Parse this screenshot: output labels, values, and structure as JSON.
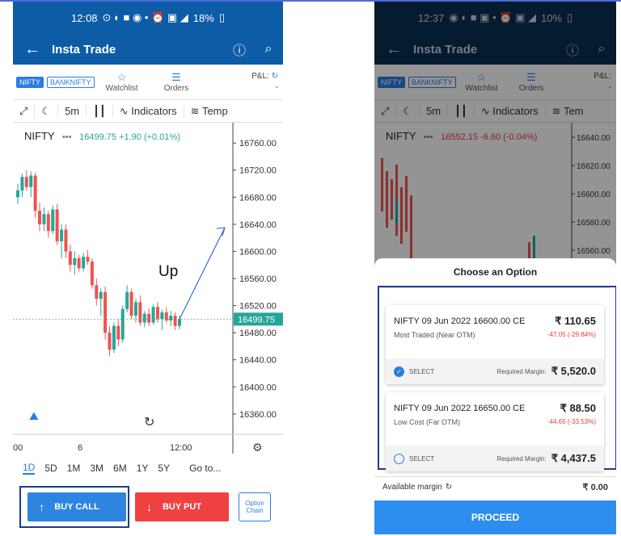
{
  "screens": [
    {
      "status": {
        "time": "12:08",
        "battery": "18%"
      },
      "appbar": {
        "title": "Insta Trade"
      },
      "tabs": {
        "chips": [
          "NIFTY",
          "BANKNIFTY"
        ],
        "watchlist": "Watchlist",
        "orders": "Orders",
        "pnl_label": "P&L:",
        "pnl_value": "-"
      },
      "toolbar": {
        "interval": "5m",
        "indicators": "Indicators",
        "template": "Temp"
      },
      "chart": {
        "symbol": "NIFTY",
        "quote": "16499.75 +1.90 (+0.01%)",
        "quote_color": "#26a69a",
        "price_tag": "16499.75",
        "annotation": "Up",
        "x_ticks": [
          "00",
          "6",
          "12:00"
        ]
      },
      "ranges": [
        "1D",
        "5D",
        "1M",
        "3M",
        "6M",
        "1Y",
        "5Y",
        "Go to..."
      ],
      "buttons": {
        "buy_call": "BUY CALL",
        "buy_put": "BUY PUT",
        "option_chain": "Option Chain"
      }
    },
    {
      "status": {
        "time": "12:37",
        "battery": "10%"
      },
      "appbar": {
        "title": "Insta Trade"
      },
      "tabs": {
        "chips": [
          "NIFTY",
          "BANKNIFTY"
        ],
        "watchlist": "Watchlist",
        "orders": "Orders",
        "pnl_label": "P&L:",
        "pnl_value": "-"
      },
      "toolbar": {
        "interval": "5m",
        "indicators": "Indicators",
        "template": "Tem"
      },
      "chart": {
        "symbol": "NIFTY",
        "quote": "16552.15 -6.60 (-0.04%)",
        "quote_color": "#e23b3b"
      },
      "sheet": {
        "title": "Choose an Option",
        "options": [
          {
            "name": "NIFTY 09 Jun 2022 16600.00 CE",
            "price": "₹ 110.65",
            "tag": "Most Traded (Near OTM)",
            "change": "-47.05 (-29.84%)",
            "select": "SELECT",
            "margin_label": "Required Margin:",
            "margin": "₹ 5,520.0",
            "selected": true
          },
          {
            "name": "NIFTY 09 Jun 2022 16650.00 CE",
            "price": "₹ 88.50",
            "tag": "Low Cost (Far OTM)",
            "change": "-44.65 (-33.53%)",
            "select": "SELECT",
            "margin_label": "Required Margin:",
            "margin": "₹ 4,437.5",
            "selected": false
          }
        ],
        "available_label": "Available margin",
        "available_value": "₹ 0.00",
        "proceed": "PROCEED"
      }
    }
  ],
  "chart_data": [
    {
      "type": "candlestick",
      "title": "NIFTY",
      "y_ticks": [
        16760,
        16720,
        16680,
        16640,
        16600,
        16560,
        16520,
        16480,
        16440,
        16400,
        16360
      ],
      "ylim": [
        16330,
        16790
      ],
      "x_ticks": [
        "00",
        "6",
        "12:00"
      ],
      "candles": [
        [
          16680,
          16700,
          16670,
          16690
        ],
        [
          16690,
          16715,
          16680,
          16710
        ],
        [
          16710,
          16720,
          16690,
          16695
        ],
        [
          16695,
          16718,
          16680,
          16712
        ],
        [
          16712,
          16716,
          16650,
          16660
        ],
        [
          16660,
          16672,
          16630,
          16640
        ],
        [
          16640,
          16665,
          16630,
          16655
        ],
        [
          16655,
          16660,
          16620,
          16630
        ],
        [
          16630,
          16668,
          16625,
          16662
        ],
        [
          16662,
          16670,
          16610,
          16615
        ],
        [
          16615,
          16640,
          16590,
          16632
        ],
        [
          16632,
          16640,
          16590,
          16600
        ],
        [
          16600,
          16610,
          16570,
          16580
        ],
        [
          16580,
          16600,
          16565,
          16590
        ],
        [
          16590,
          16595,
          16570,
          16575
        ],
        [
          16575,
          16598,
          16570,
          16592
        ],
        [
          16592,
          16602,
          16580,
          16585
        ],
        [
          16585,
          16590,
          16545,
          16550
        ],
        [
          16550,
          16560,
          16520,
          16530
        ],
        [
          16530,
          16545,
          16505,
          16540
        ],
        [
          16540,
          16548,
          16470,
          16480
        ],
        [
          16480,
          16490,
          16445,
          16455
        ],
        [
          16455,
          16495,
          16450,
          16490
        ],
        [
          16490,
          16500,
          16460,
          16470
        ],
        [
          16470,
          16520,
          16465,
          16515
        ],
        [
          16515,
          16550,
          16510,
          16540
        ],
        [
          16540,
          16545,
          16500,
          16505
        ],
        [
          16505,
          16530,
          16495,
          16525
        ],
        [
          16525,
          16535,
          16490,
          16495
        ],
        [
          16495,
          16512,
          16488,
          16508
        ],
        [
          16508,
          16516,
          16490,
          16495
        ],
        [
          16495,
          16522,
          16492,
          16518
        ],
        [
          16518,
          16525,
          16495,
          16500
        ],
        [
          16500,
          16514,
          16484,
          16510
        ],
        [
          16510,
          16518,
          16494,
          16498
        ],
        [
          16498,
          16512,
          16490,
          16505
        ],
        [
          16505,
          16510,
          16484,
          16490
        ],
        [
          16490,
          16505,
          16485,
          16500
        ]
      ],
      "annotation": {
        "label": "Up",
        "from_index": 37,
        "to_price": 16635
      }
    }
  ]
}
